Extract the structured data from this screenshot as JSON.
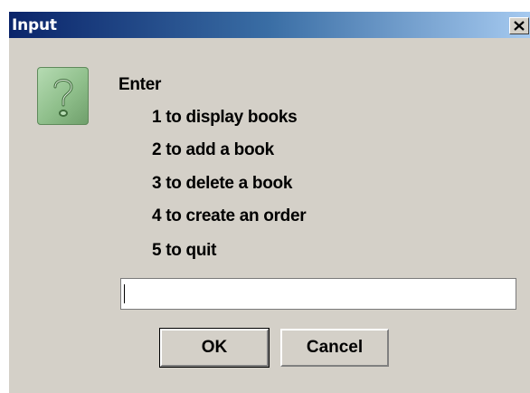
{
  "window": {
    "title": "Input",
    "close_icon": "close-icon"
  },
  "dialog": {
    "icon": "question-icon",
    "prompt_heading": "Enter",
    "options": [
      "1 to display books",
      "2 to add a book",
      "3 to delete a book",
      "4 to create an order",
      "5 to quit"
    ],
    "input": {
      "value": "",
      "placeholder": ""
    },
    "buttons": {
      "ok": "OK",
      "cancel": "Cancel"
    }
  },
  "colors": {
    "title_gradient_start": "#0a246a",
    "title_gradient_end": "#a6caf0",
    "dialog_bg": "#d4d0c8",
    "icon_green": "#8fbf8b"
  }
}
